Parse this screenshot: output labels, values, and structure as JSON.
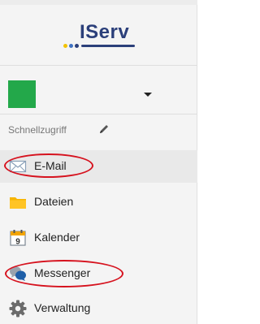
{
  "brand": {
    "name": "IServ"
  },
  "quickaccess": {
    "label": "Schnellzugriff",
    "edit_icon": "pencil-icon"
  },
  "nav": [
    {
      "label": "E-Mail",
      "icon": "mail-icon"
    },
    {
      "label": "Dateien",
      "icon": "folder-icon"
    },
    {
      "label": "Kalender",
      "icon": "calendar-icon",
      "icon_text": "9"
    },
    {
      "label": "Messenger",
      "icon": "chat-icon"
    },
    {
      "label": "Verwaltung",
      "icon": "gear-icon"
    }
  ],
  "colors": {
    "brand": "#2b3f7a",
    "accent_yellow": "#f2c200",
    "accent_blue": "#3f72c3",
    "avatar": "#23a84a",
    "folder": "#f7b500",
    "highlight": "#d6121e"
  }
}
